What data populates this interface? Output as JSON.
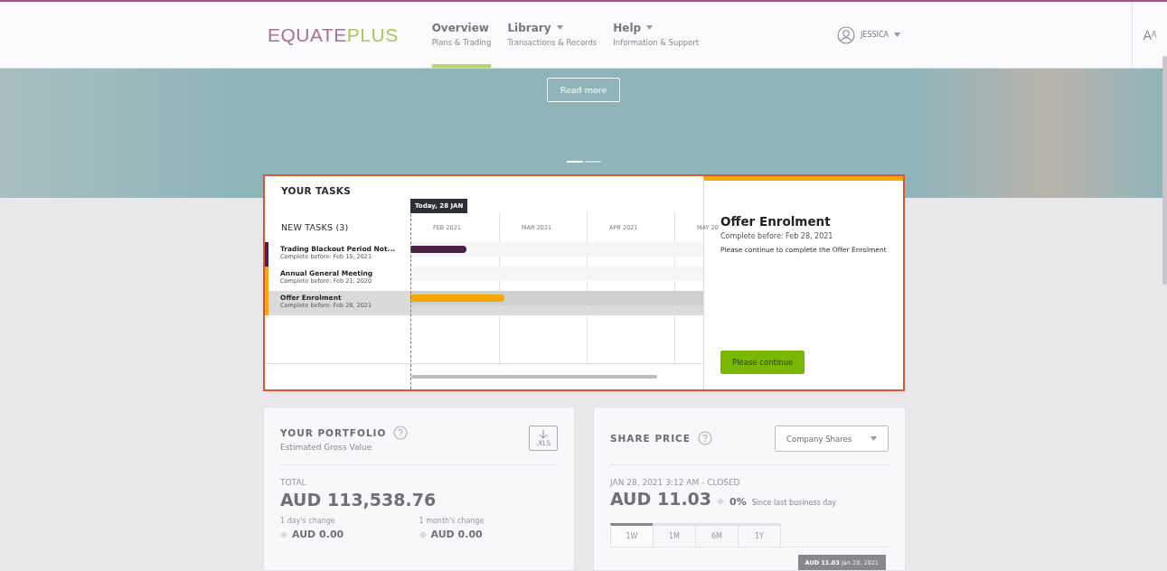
{
  "header": {
    "logo": {
      "part_1": "EQUATE",
      "part_2": "PLUS"
    },
    "nav": [
      {
        "label": "Overview",
        "sublabel": "Plans & Trading",
        "dropdown": false,
        "selected": true
      },
      {
        "label": "Library",
        "sublabel": "Transactions & Records",
        "dropdown": true,
        "selected": false
      },
      {
        "label": "Help",
        "sublabel": "Information & Support",
        "dropdown": true,
        "selected": false
      }
    ],
    "user": {
      "name": "JESSICA"
    },
    "font_size_button": "A$^{A}$"
  },
  "banner": {
    "button": "Read more",
    "slides": [
      {
        "selected": true
      },
      {
        "selected": false
      }
    ]
  },
  "tasks": {
    "title": "YOUR TASKS",
    "today": "Today, 28 JAN",
    "list_title": "NEW TASKS (3)",
    "months": [
      "FEB 2021",
      "MAR 2021",
      "APR 2021",
      "MAY 20"
    ],
    "items": [
      {
        "name": "Trading Blackout Period Not...",
        "due": "Complete before: Feb 15, 2021",
        "color": "#4b2245",
        "level": 0.19,
        "selected": false
      },
      {
        "name": "Annual General Meeting",
        "due": "Complete before: Feb 21, 2020",
        "color": "#f5a800",
        "selected": false
      },
      {
        "name": "Offer Enrolment",
        "due": "Complete before: Feb 28, 2021",
        "color": "#f5a800",
        "level": 0.32,
        "selected": true
      }
    ],
    "detail": {
      "title": "Offer Enrolment",
      "due": "Complete before: Feb 28, 2021",
      "text": "Please continue to complete the Offer Enrolment",
      "button": "Please continue"
    }
  },
  "portfolio": {
    "title": "YOUR PORTFOLIO",
    "subtitle": "Estimated Gross Value",
    "export": ".XLS",
    "total_label": "TOTAL",
    "total": "AUD 113,538.76",
    "changes": [
      {
        "label": "1 day's change",
        "value": "AUD 0.00"
      },
      {
        "label": "1 month's change",
        "value": "AUD 0.00"
      }
    ]
  },
  "share_price": {
    "title": "SHARE PRICE",
    "select": "Company Shares",
    "timestamp": "JAN 28, 2021 3:12 AM - CLOSED",
    "price": "AUD 11.03",
    "change": "0%",
    "change_note": "Since last business day",
    "ranges": [
      {
        "label": "1W",
        "selected": true
      },
      {
        "label": "1M",
        "selected": false
      },
      {
        "label": "6M",
        "selected": false
      },
      {
        "label": "1Y",
        "selected": false
      }
    ],
    "tooltip": "**AUD 11.03** Jan 28, 2021"
  }
}
